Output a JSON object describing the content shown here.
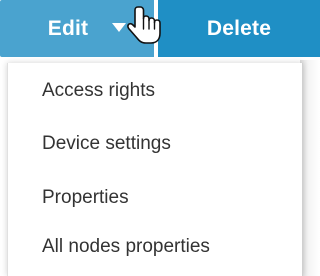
{
  "toolbar": {
    "edit_label": "Edit",
    "delete_label": "Delete"
  },
  "menu": {
    "items": [
      {
        "label": "Access rights"
      },
      {
        "label": "Device settings"
      },
      {
        "label": "Properties"
      },
      {
        "label": "All nodes properties"
      }
    ]
  },
  "icons": {
    "caret": "caret-down-icon",
    "cursor": "hand-pointer-icon"
  },
  "colors": {
    "edit_button": "#4aa3cf",
    "delete_button": "#1f8fc5",
    "menu_text": "#333333"
  }
}
